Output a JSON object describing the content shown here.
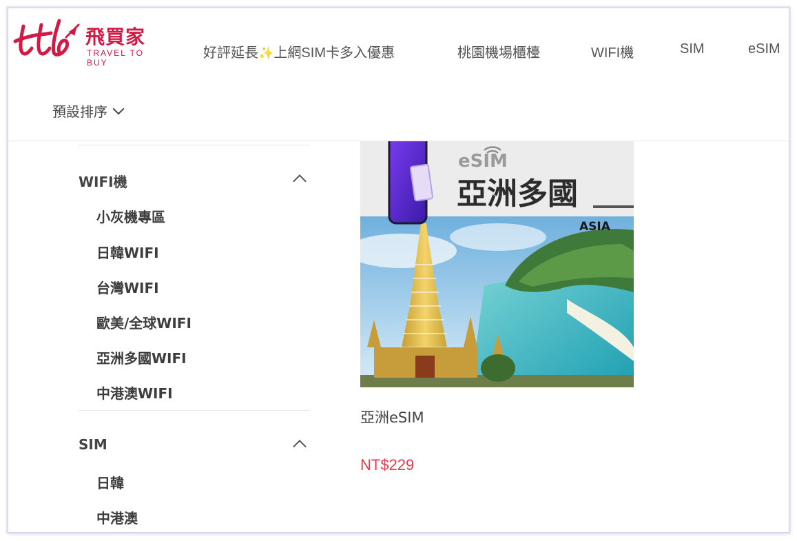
{
  "brand": {
    "logo_script": "ttb",
    "name_zh": "飛買家",
    "name_en": "TRAVEL TO BUY",
    "color": "#d21a45"
  },
  "nav": {
    "items": [
      {
        "label_before": "好評延長",
        "icon": "sparkles-icon",
        "label_after": "上網SIM卡多入優惠"
      },
      {
        "label": "桃園機場櫃檯"
      },
      {
        "label": "WIFI機"
      },
      {
        "label": "SIM"
      },
      {
        "label": "eSIM"
      }
    ]
  },
  "sort": {
    "label": "預設排序",
    "icon": "chevron-down-icon"
  },
  "sidebar": {
    "categories": [
      {
        "title": "WIFI機",
        "expanded": true,
        "items": [
          "小灰機專區",
          "日韓WIFI",
          "台灣WIFI",
          "歐美/全球WIFI",
          "亞洲多國WIFI",
          "中港澳WIFI"
        ]
      },
      {
        "title": "SIM",
        "expanded": true,
        "items": [
          "日韓",
          "中港澳"
        ]
      }
    ]
  },
  "product": {
    "image": {
      "badge": "eSIM",
      "title": "亞洲多國",
      "subtitle": "ASIA"
    },
    "name": "亞洲eSIM",
    "price": "NT$229",
    "price_color": "#e53a4a"
  }
}
